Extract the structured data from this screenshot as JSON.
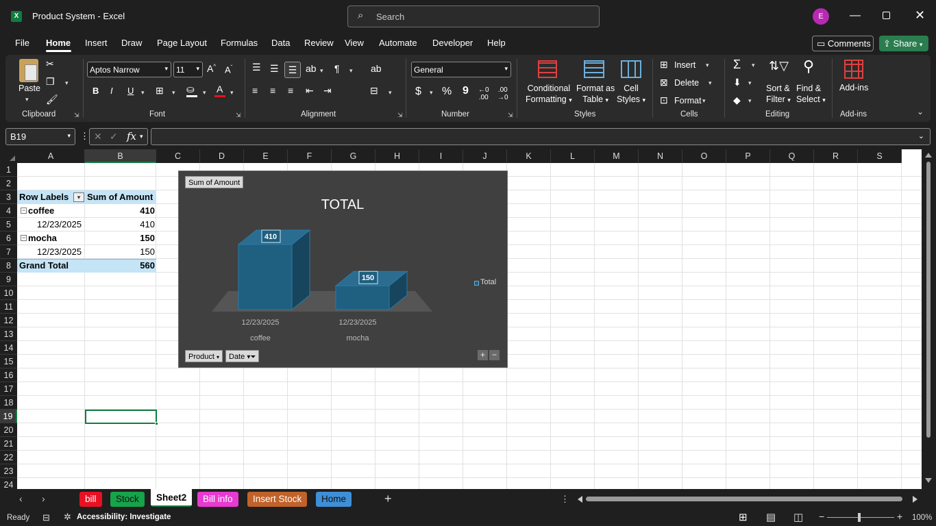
{
  "window": {
    "app_label": "Product System",
    "separator": "-",
    "app_name": "Excel",
    "avatar_letter": "E"
  },
  "search": {
    "placeholder": "Search"
  },
  "menu": {
    "file": "File",
    "home": "Home",
    "insert": "Insert",
    "draw": "Draw",
    "page_layout": "Page Layout",
    "formulas": "Formulas",
    "data": "Data",
    "review": "Review",
    "view": "View",
    "automate": "Automate",
    "developer": "Developer",
    "help": "Help",
    "comments": "Comments",
    "share": "Share"
  },
  "ribbon": {
    "clipboard": {
      "paste": "Paste",
      "label": "Clipboard"
    },
    "font": {
      "name": "Aptos Narrow",
      "size": "11",
      "label": "Font",
      "bold": "B",
      "italic": "I",
      "underline": "U"
    },
    "alignment": {
      "label": "Alignment"
    },
    "number": {
      "format": "General",
      "label": "Number",
      "currency": "$",
      "percent": "%",
      "comma": "9"
    },
    "styles": {
      "cond1": "Conditional",
      "cond2": "Formatting",
      "fmt1": "Format as",
      "fmt2": "Table",
      "cell1": "Cell",
      "cell2": "Styles",
      "label": "Styles"
    },
    "cells": {
      "insert": "Insert",
      "delete": "Delete",
      "format": "Format",
      "label": "Cells"
    },
    "editing": {
      "sort1": "Sort &",
      "sort2": "Filter",
      "find1": "Find &",
      "find2": "Select",
      "label": "Editing"
    },
    "addins": {
      "btn": "Add-ins",
      "label": "Add-ins"
    }
  },
  "formula_bar": {
    "name_box": "B19",
    "value": ""
  },
  "columns": [
    "A",
    "B",
    "C",
    "D",
    "E",
    "F",
    "G",
    "H",
    "I",
    "J",
    "K",
    "L",
    "M",
    "N",
    "O",
    "P",
    "Q",
    "R",
    "S"
  ],
  "rows": [
    "1",
    "2",
    "3",
    "4",
    "5",
    "6",
    "7",
    "8",
    "9",
    "10",
    "11",
    "12",
    "13",
    "14",
    "15",
    "16",
    "17",
    "18",
    "19",
    "20",
    "21",
    "22",
    "23",
    "24"
  ],
  "pivot": {
    "header_row": "Row Labels",
    "header_sum": "Sum of Amount",
    "coffee": "coffee",
    "coffee_total": "410",
    "coffee_date": "12/23/2025",
    "coffee_amount": "410",
    "mocha": "mocha",
    "mocha_total": "150",
    "mocha_date": "12/23/2025",
    "mocha_amount": "150",
    "grand_total": "Grand Total",
    "grand_total_value": "560"
  },
  "chart_data": {
    "type": "bar",
    "title": "TOTAL",
    "field_button": "Sum of Amount",
    "categories": [
      {
        "date": "12/23/2025",
        "product": "coffee"
      },
      {
        "date": "12/23/2025",
        "product": "mocha"
      }
    ],
    "series": [
      {
        "name": "Total",
        "values": [
          410,
          150
        ]
      }
    ],
    "legend": "right",
    "axis_buttons": {
      "product": "Product",
      "date": "Date"
    },
    "colors": {
      "bar": "#1f5f80",
      "background": "#404040"
    }
  },
  "sheets": [
    {
      "name": "bill",
      "color": "#e81123"
    },
    {
      "name": "Stock",
      "color": "#16a34a"
    },
    {
      "name": "Sheet2",
      "color": "#ffffff"
    },
    {
      "name": "Bill info",
      "color": "#e83ad0"
    },
    {
      "name": "Insert Stock",
      "color": "#c0622a"
    },
    {
      "name": "Home",
      "color": "#3f8fd8"
    }
  ],
  "status": {
    "ready": "Ready",
    "accessibility": "Accessibility: Investigate",
    "zoom": "100%"
  }
}
